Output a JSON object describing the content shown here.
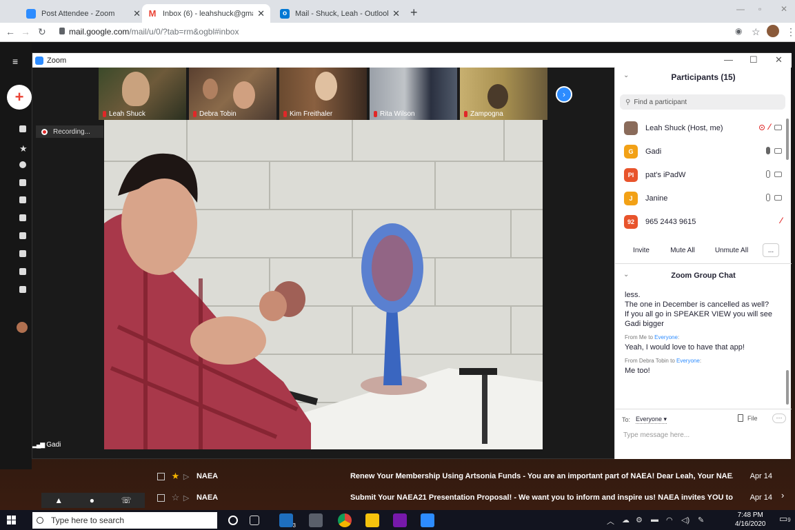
{
  "browser": {
    "tabs": [
      {
        "label": "Post Attendee - Zoom",
        "color": "#2d8cff",
        "glyph": "▭"
      },
      {
        "label": "Inbox (6) - leahshuck@gmail.co",
        "color": "#ffffff",
        "glyph": "M"
      },
      {
        "label": "Mail - Shuck, Leah - Outlook",
        "color": "#0078d4",
        "glyph": "O"
      }
    ],
    "url_host": "mail.google.com",
    "url_path": "/mail/u/0/?tab=rm&ogbl#inbox"
  },
  "zoom": {
    "window_title": "Zoom",
    "recording_label": "Recording...",
    "active_speaker": "Gadi",
    "thumbnails": [
      {
        "name": "Leah Shuck"
      },
      {
        "name": "Debra Tobin"
      },
      {
        "name": "Kim Freithaler"
      },
      {
        "name": "Rita Wilson"
      },
      {
        "name": "Zampogna"
      }
    ],
    "participants_panel": {
      "title": "Participants (15)",
      "search_placeholder": "Find a participant",
      "participants": [
        {
          "name": "Leah Shuck (Host, me)",
          "avatar": "",
          "color": "#8a6b5a"
        },
        {
          "name": "Gadi",
          "avatar": "G",
          "color": "#f2a116"
        },
        {
          "name": "pat's iPadW",
          "avatar": "PI",
          "color": "#e8542c"
        },
        {
          "name": "Janine",
          "avatar": "J",
          "color": "#f2a116"
        },
        {
          "name": "965 2443 9615",
          "avatar": "92",
          "color": "#e8542c"
        }
      ],
      "buttons": {
        "invite": "Invite",
        "mute_all": "Mute All",
        "unmute_all": "Unmute All",
        "more": "..."
      }
    },
    "chat": {
      "title": "Zoom Group Chat",
      "messages": [
        {
          "text": "less."
        },
        {
          "text": "The one in December is cancelled as well?"
        },
        {
          "text": "If you all go in SPEAKER VIEW you will see Gadi bigger"
        }
      ],
      "msg1": {
        "from": "From Me to",
        "to": "Everyone",
        "text": "Yeah, I would love to have that app!"
      },
      "msg2": {
        "from": "From Debra Tobin to",
        "to": "Everyone",
        "text": "Me too!"
      },
      "to_label": "To:",
      "to_value": "Everyone",
      "file_label": "File",
      "more": "···",
      "input_placeholder": "Type message here..."
    }
  },
  "gmail": {
    "rows": [
      {
        "sender": "NAEA",
        "subject": "Renew Your Membership Using Artsonia Funds - You are an important part of NAEA! Dear Leah, Your NAEA ...",
        "date": "Apr 14",
        "starred": true
      },
      {
        "sender": "NAEA",
        "subject": "Submit Your NAEA21 Presentation Proposal! - We want you to inform and inspire us! NAEA invites YOU to s...",
        "date": "Apr 14",
        "starred": false
      }
    ]
  },
  "taskbar": {
    "search_placeholder": "Type here to search",
    "time": "7:48 PM",
    "date": "4/16/2020",
    "notification_count": "9",
    "mail_badge": "3"
  }
}
